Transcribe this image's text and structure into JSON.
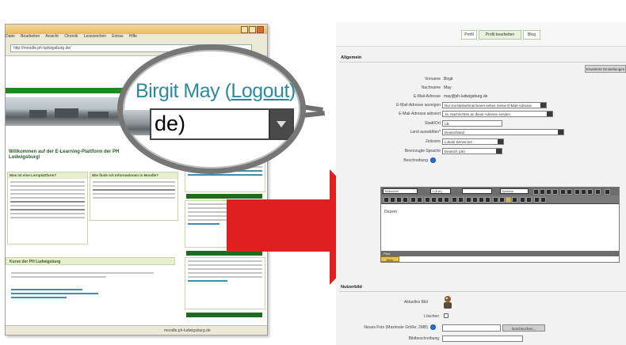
{
  "browser": {
    "menu": [
      "Datei",
      "Bearbeiten",
      "Ansicht",
      "Chronik",
      "Lesezeichen",
      "Extras",
      "Hilfe"
    ],
    "url": "http://moodle.ph-ludwigsburg.de/",
    "welcome": "Willkommen auf der E-Learning-Plattform der PH Ludwigsburg!",
    "box_left_title": "Was ist eine Lernplattform?",
    "box_mid_title": "Wie finde ich Informationen in Moodle?",
    "section_title": "Kurse der PH Ludwigsburg",
    "status": "moodle.ph-ludwigsburg.de"
  },
  "magnifier": {
    "user_name": "Birgit May",
    "logout_open": "(",
    "logout_label": "Logout",
    "logout_close": ")",
    "language_partial": "de)"
  },
  "form": {
    "tabs": [
      "Profil",
      "Profil bearbeiten",
      "Blog"
    ],
    "section_general": "Allgemein",
    "customize_button": "Erweiterte Einstellungen",
    "fields": [
      {
        "label": "Vorname",
        "value": "Birgit"
      },
      {
        "label": "Nachname",
        "value": "May"
      },
      {
        "label": "E-Mail-Adresse",
        "value": "may@ph-ludwigsburg.de"
      },
      {
        "label": "E-Mail-Adresse anzeigen",
        "value": "Nur Kursteilnehmer/innen sehen meine E-Mail-Adresse"
      },
      {
        "label": "E-Mail-Adresse aktiviert",
        "value": "Ja, Nachrichten an diese Adresse senden"
      },
      {
        "label": "Stadt/Ort",
        "value": "LB"
      },
      {
        "label": "Land auswählen*",
        "value": "Deutschland"
      },
      {
        "label": "Zeitzone",
        "value": "Lokale Serverzeit"
      },
      {
        "label": "Bevorzugte Sprache",
        "value": "Deutsch (de)"
      },
      {
        "label": "Beschreibung",
        "value": ""
      }
    ],
    "editor": {
      "font_family": "Trebuchet",
      "font_size": "1 (8 pt)",
      "lang": "Sprache",
      "content": "Dozent",
      "path_label": "Pfad:",
      "more_button": "Mehr"
    },
    "section_image": "Nutzerbild",
    "image_label": "Aktuelles Bild",
    "delete_label": "Löschen",
    "upload_label": "Neues Foto (Maximale Größe: 2MB)",
    "browse_button": "Durchsuchen...",
    "image_desc_label": "Bildbeschreibung"
  },
  "colors": {
    "accent_green": "#1e8a1e",
    "magnifier_link": "#2d8a9e",
    "arrow": "#e02020"
  }
}
